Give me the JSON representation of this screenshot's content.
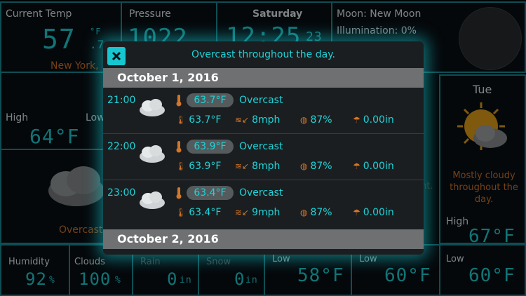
{
  "dashboard": {
    "current_temp": {
      "label": "Current Temp",
      "value": "57",
      "unit_top": "°F",
      "unit_bottom": ".7",
      "location": "New York,"
    },
    "pressure": {
      "label": "Pressure",
      "value": "1022"
    },
    "clock": {
      "day": "Saturday",
      "time": "12:25",
      "seconds": "23"
    },
    "moon": {
      "phase": "Moon: New Moon",
      "illumination": "Illumination: 0%"
    },
    "high": {
      "label": "High",
      "value": "64°F"
    },
    "low_partial": "Low",
    "left_condition": "Overcast",
    "forecast_tue": {
      "day": "Tue",
      "description": "Mostly cloudy throughout the day.",
      "high_label": "High",
      "high_value": "67°F",
      "low_label": "Low",
      "low_value": "60°F"
    },
    "bottom": {
      "humidity": {
        "label": "Humidity",
        "value": "92",
        "unit": "%"
      },
      "clouds": {
        "label": "Clouds",
        "value": "100",
        "unit": "%"
      },
      "rain": {
        "label": "Rain",
        "value": "0",
        "unit": "in"
      },
      "snow": {
        "label": "Snow",
        "value": "0",
        "unit": "in"
      },
      "low1": {
        "label": "Low",
        "value": "58°F"
      },
      "low2": {
        "label": "Low",
        "value": "60°F"
      }
    },
    "partial_right": "nt."
  },
  "modal": {
    "title": "Overcast throughout the day.",
    "date1": "October 1, 2016",
    "date2": "October 2, 2016",
    "hours": [
      {
        "time": "21:00",
        "temp": "63.7°F",
        "condition": "Overcast",
        "feels": "63.7°F",
        "wind": "8mph",
        "humidity": "87%",
        "precip": "0.00in"
      },
      {
        "time": "22:00",
        "temp": "63.9°F",
        "condition": "Overcast",
        "feels": "63.9°F",
        "wind": "8mph",
        "humidity": "87%",
        "precip": "0.00in"
      },
      {
        "time": "23:00",
        "temp": "63.4°F",
        "condition": "Overcast",
        "feels": "63.4°F",
        "wind": "9mph",
        "humidity": "87%",
        "precip": "0.00in"
      }
    ]
  },
  "colors": {
    "accent": "#1fd3d8",
    "orange": "#d4762a",
    "border": "#1a8f98"
  }
}
